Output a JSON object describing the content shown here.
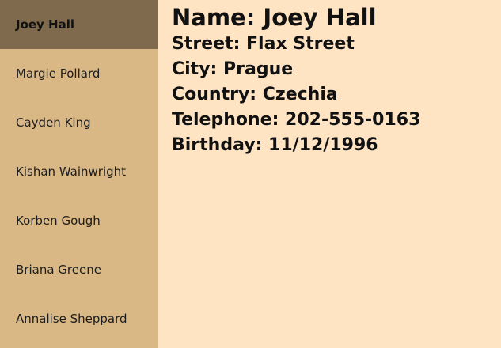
{
  "sidebar": {
    "items": [
      {
        "label": "Joey Hall"
      },
      {
        "label": "Margie Pollard"
      },
      {
        "label": "Cayden King"
      },
      {
        "label": "Kishan Wainwright"
      },
      {
        "label": "Korben Gough"
      },
      {
        "label": "Briana Greene"
      },
      {
        "label": "Annalise Sheppard"
      }
    ],
    "selected_label": "Joey Hall"
  },
  "detail": {
    "name": "Name: Joey Hall",
    "street": "Street: Flax Street",
    "city": "City: Prague",
    "country": "Country: Czechia",
    "telephone": "Telephone: 202-555-0163",
    "birthday": "Birthday: 11/12/1996"
  },
  "colors": {
    "sidebar_bg": "#d9b886",
    "sidebar_active_bg": "#7f6a4e",
    "main_bg": "#ffe4c4"
  }
}
